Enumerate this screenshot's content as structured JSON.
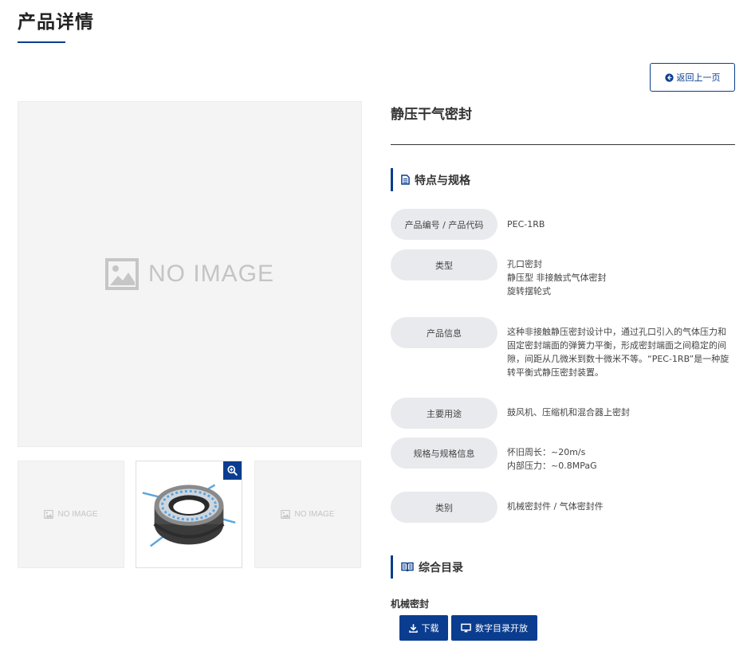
{
  "page": {
    "title": "产品详情"
  },
  "toolbar": {
    "back_label": "返回上一页"
  },
  "product": {
    "name": "静压干气密封",
    "main_image_placeholder": "NO IMAGE",
    "thumbs": [
      {
        "placeholder": "NO IMAGE"
      },
      {
        "type": "bearing-seal-image"
      },
      {
        "placeholder": "NO IMAGE"
      }
    ]
  },
  "features": {
    "heading": "特点与规格",
    "rows": [
      {
        "label": "产品编号 / 产品代码",
        "lines": [
          "PEC-1RB"
        ]
      },
      {
        "label": "类型",
        "lines": [
          "孔口密封",
          "静压型 非接触式气体密封",
          "旋转摆轮式"
        ]
      },
      {
        "label": "产品信息",
        "lines": [
          "这种非接触静压密封设计中，通过孔口引入的气体压力和",
          "固定密封端面的弹簧力平衡，形成密封端面之间稳定的间",
          "隙，间距从几微米到数十微米不等。“PEC-1RB”是一种旋",
          "转平衡式静压密封装置。"
        ]
      },
      {
        "label": "主要用途",
        "lines": [
          "鼓风机、压缩机和混合器上密封"
        ]
      },
      {
        "label": "规格与规格信息",
        "lines": [
          "怀旧周长：~20m/s",
          "内部压力：~0.8MPaG"
        ]
      },
      {
        "label": "类别",
        "lines": [
          "机械密封件 / 气体密封件"
        ]
      }
    ]
  },
  "catalog": {
    "heading": "综合目录",
    "group_label": "机械密封",
    "download_label": "下载",
    "digital_label": "数字目录开放"
  },
  "colors": {
    "accent": "#0a3d8f",
    "label_bg": "#e8eaed",
    "placeholder_bg": "#f4f4f4"
  }
}
